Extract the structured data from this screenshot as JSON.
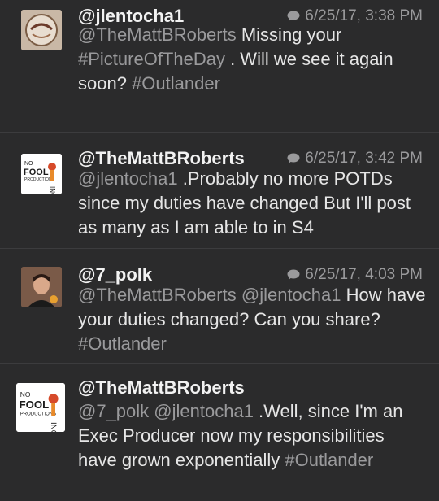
{
  "colors": {
    "background": "#2b2b2c",
    "text": "#e6e6e6",
    "muted": "#9a9a9c"
  },
  "tweets": [
    {
      "handle": "@jlentocha1",
      "timestamp": "6/25/17, 3:38 PM",
      "avatar_icon": "photo-avatar-icon",
      "body": [
        {
          "text": "@TheMattBRoberts",
          "link": true
        },
        {
          "text": " Missing your ",
          "link": false
        },
        {
          "text": "#PictureOfTheDay",
          "link": true
        },
        {
          "text": " .  Will we see it again soon? ",
          "link": false
        },
        {
          "text": "#Outlander",
          "link": true
        }
      ]
    },
    {
      "handle": "@TheMattBRoberts",
      "timestamp": "6/25/17, 3:42 PM",
      "avatar_icon": "no-fooling-productions-logo-icon",
      "body": [
        {
          "text": "@jlentocha1",
          "link": true
        },
        {
          "text": " .Probably no more POTDs since my duties have changed But I'll post as many as I am able to in S4",
          "link": false
        }
      ]
    },
    {
      "handle": "@7_polk",
      "timestamp": "6/25/17, 4:03 PM",
      "avatar_icon": "photo-avatar-icon",
      "body": [
        {
          "text": "@TheMattBRoberts",
          "link": true
        },
        {
          "text": " ",
          "link": false
        },
        {
          "text": "@jlentocha1",
          "link": true
        },
        {
          "text": " How have your duties changed? Can you share? ",
          "link": false
        },
        {
          "text": "#Outlander",
          "link": true
        }
      ]
    },
    {
      "handle": "@TheMattBRoberts",
      "timestamp": "",
      "avatar_icon": "no-fooling-productions-logo-icon",
      "body": [
        {
          "text": "@7_polk",
          "link": true
        },
        {
          "text": " ",
          "link": false
        },
        {
          "text": "@jlentocha1",
          "link": true
        },
        {
          "text": " .Well, since I'm an Exec Producer now my responsibilities have grown exponentially ",
          "link": false
        },
        {
          "text": "#Outlander",
          "link": true
        }
      ]
    }
  ]
}
